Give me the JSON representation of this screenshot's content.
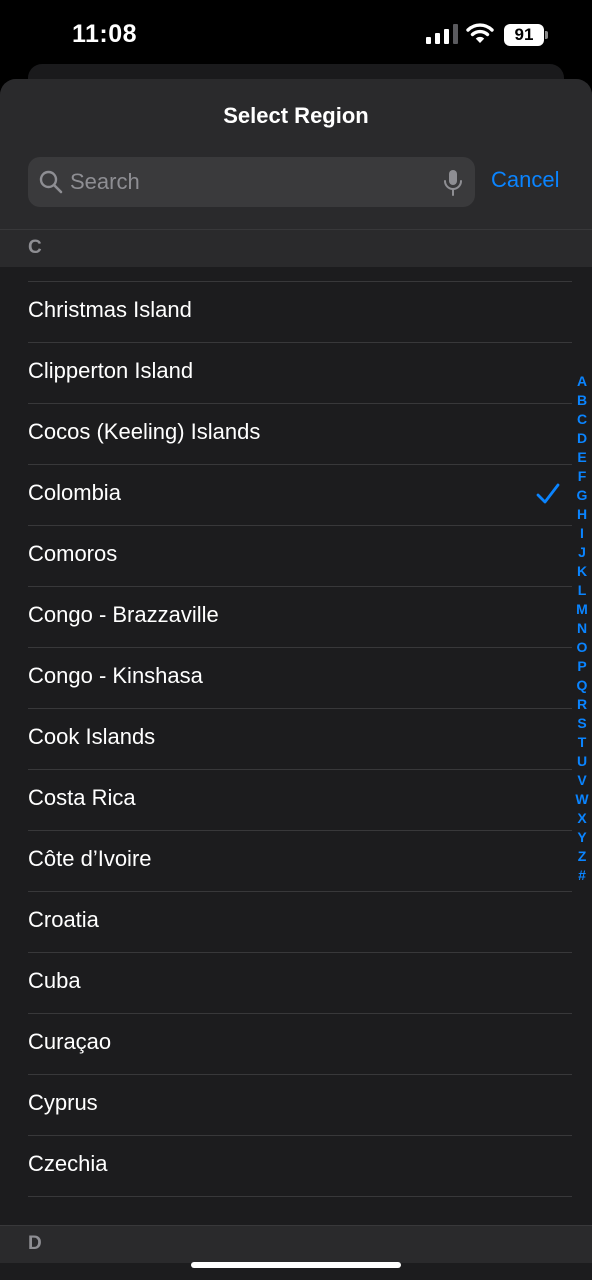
{
  "status_bar": {
    "time": "11:08",
    "battery": "91"
  },
  "sheet": {
    "title": "Select Region",
    "search": {
      "placeholder": "Search",
      "value": ""
    },
    "cancel_label": "Cancel"
  },
  "sections": [
    {
      "letter": "C",
      "items": [
        {
          "label": "Christmas Island",
          "selected": false
        },
        {
          "label": "Clipperton Island",
          "selected": false
        },
        {
          "label": "Cocos (Keeling) Islands",
          "selected": false
        },
        {
          "label": "Colombia",
          "selected": true
        },
        {
          "label": "Comoros",
          "selected": false
        },
        {
          "label": "Congo - Brazzaville",
          "selected": false
        },
        {
          "label": "Congo - Kinshasa",
          "selected": false
        },
        {
          "label": "Cook Islands",
          "selected": false
        },
        {
          "label": "Costa Rica",
          "selected": false
        },
        {
          "label": "Côte d’Ivoire",
          "selected": false
        },
        {
          "label": "Croatia",
          "selected": false
        },
        {
          "label": "Cuba",
          "selected": false
        },
        {
          "label": "Curaçao",
          "selected": false
        },
        {
          "label": "Cyprus",
          "selected": false
        },
        {
          "label": "Czechia",
          "selected": false
        }
      ]
    },
    {
      "letter": "D",
      "items": []
    }
  ],
  "index_letters": [
    "A",
    "B",
    "C",
    "D",
    "E",
    "F",
    "G",
    "H",
    "I",
    "J",
    "K",
    "L",
    "M",
    "N",
    "O",
    "P",
    "Q",
    "R",
    "S",
    "T",
    "U",
    "V",
    "W",
    "X",
    "Y",
    "Z",
    "#"
  ],
  "colors": {
    "accent": "#0a84ff",
    "sheet_bg": "#1c1c1e",
    "header_bg": "#2a2a2c",
    "separator": "#38383a"
  }
}
